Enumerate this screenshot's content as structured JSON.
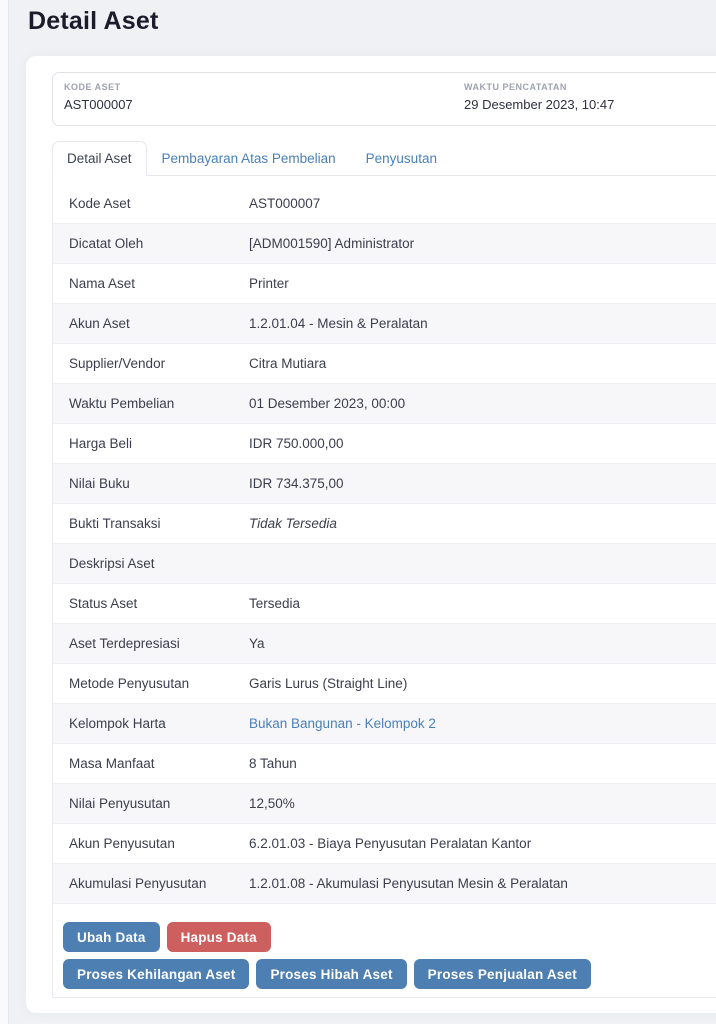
{
  "page": {
    "title": "Detail Aset"
  },
  "summary": {
    "fields": [
      {
        "label": "KODE ASET",
        "value": "AST000007"
      },
      {
        "label": "WAKTU PENCATATAN",
        "value": "29 Desember 2023, 10:47"
      }
    ]
  },
  "tabs": [
    {
      "label": "Detail Aset",
      "active": true
    },
    {
      "label": "Pembayaran Atas Pembelian",
      "active": false
    },
    {
      "label": "Penyusutan",
      "active": false
    }
  ],
  "detail": {
    "rows": [
      {
        "label": "Kode Aset",
        "value": "AST000007",
        "style": "plain"
      },
      {
        "label": "Dicatat Oleh",
        "value": "[ADM001590] Administrator",
        "style": "plain"
      },
      {
        "label": "Nama Aset",
        "value": "Printer",
        "style": "plain"
      },
      {
        "label": "Akun Aset",
        "value": "1.2.01.04 - Mesin & Peralatan",
        "style": "plain"
      },
      {
        "label": "Supplier/Vendor",
        "value": "Citra Mutiara",
        "style": "plain"
      },
      {
        "label": "Waktu Pembelian",
        "value": "01 Desember 2023, 00:00",
        "style": "plain"
      },
      {
        "label": "Harga Beli",
        "value": "IDR 750.000,00",
        "style": "plain"
      },
      {
        "label": "Nilai Buku",
        "value": "IDR 734.375,00",
        "style": "plain"
      },
      {
        "label": "Bukti Transaksi",
        "value": "Tidak Tersedia",
        "style": "italic"
      },
      {
        "label": "Deskripsi Aset",
        "value": "",
        "style": "plain"
      },
      {
        "label": "Status Aset",
        "value": "Tersedia",
        "style": "plain"
      },
      {
        "label": "Aset Terdepresiasi",
        "value": "Ya",
        "style": "plain"
      },
      {
        "label": "Metode Penyusutan",
        "value": "Garis Lurus (Straight Line)",
        "style": "plain"
      },
      {
        "label": "Kelompok Harta",
        "value": "Bukan Bangunan - Kelompok 2",
        "style": "link"
      },
      {
        "label": "Masa Manfaat",
        "value": "8 Tahun",
        "style": "plain"
      },
      {
        "label": "Nilai Penyusutan",
        "value": "12,50%",
        "style": "plain"
      },
      {
        "label": "Akun Penyusutan",
        "value": "6.2.01.03 - Biaya Penyusutan Peralatan Kantor",
        "style": "plain"
      },
      {
        "label": "Akumulasi Penyusutan",
        "value": "1.2.01.08 - Akumulasi Penyusutan Mesin & Peralatan",
        "style": "plain"
      }
    ]
  },
  "actions": {
    "primary": [
      {
        "label": "Ubah Data",
        "variant": "blue"
      },
      {
        "label": "Hapus Data",
        "variant": "red"
      }
    ],
    "secondary": [
      {
        "label": "Proses Kehilangan Aset",
        "variant": "blue"
      },
      {
        "label": "Proses Hibah Aset",
        "variant": "blue"
      },
      {
        "label": "Proses Penjualan Aset",
        "variant": "blue"
      }
    ]
  },
  "colors": {
    "accent_blue": "#4d7fb2",
    "danger_red": "#cd5f5f",
    "link_blue": "#4a80ba"
  }
}
